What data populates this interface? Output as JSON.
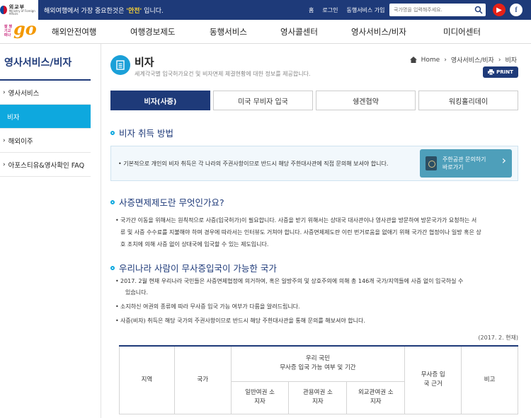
{
  "topbar": {
    "logo_main": "외교부",
    "logo_sub": "Ministry of Foreign Affairs",
    "slogan_before": "해외여행에서 가장 중요한것은 ",
    "slogan_highlight": "'안전'",
    "slogan_after": " 입니다.",
    "links": [
      "홈",
      "로그인",
      "동행서비스 가입"
    ],
    "search_placeholder": "국가명을 입력해주세요.",
    "youtube_label": "▶",
    "facebook_label": "f"
  },
  "brand": {
    "small": "잘 챙기고 떠나",
    "big": "go"
  },
  "nav": {
    "items": [
      "해외안전여행",
      "여행경보제도",
      "동행서비스",
      "영사콜센터",
      "영사서비스/비자",
      "미디어센터"
    ]
  },
  "sidebar": {
    "title": "영사서비스/비자",
    "items": [
      {
        "label": "영사서비스",
        "active": false
      },
      {
        "label": "비자",
        "active": true
      },
      {
        "label": "해외이주",
        "active": false
      },
      {
        "label": "아포스티유&영사확인 FAQ",
        "active": false
      }
    ]
  },
  "header": {
    "title": "비자",
    "description": "세계각국별 입국허가요건 및 비자면제 체결현황에 대한 정보를 제공합니다.",
    "breadcrumb": [
      "Home",
      "영사서비스/비자",
      "비자"
    ],
    "print_label": "PRINT"
  },
  "tabs": [
    {
      "label": "비자(사증)",
      "active": true
    },
    {
      "label": "미국 무비자 입국",
      "active": false
    },
    {
      "label": "쉥겐협약",
      "active": false
    },
    {
      "label": "워킹홀리데이",
      "active": false
    }
  ],
  "section1": {
    "title": "비자 취득 방법",
    "info": "• 기본적으로 개인의 비자 취득은 각 나라의 주권사항이므로 반드시 해당 주한대사관에 직접 문의해 보셔야 합니다.",
    "button_line1": "주한공관 문의하기",
    "button_line2": "바로가기"
  },
  "section2": {
    "title": "사증면제제도란 무엇인가요?",
    "line1": "국가간 이동을 위해서는 원칙적으로 사증(입국허가)이 필요합니다. 사증을 받기 위해서는 상대국 대사관이나 영사관을 방문하여 방문국가가 요청하는 서",
    "line2": "류 및 사증 수수료를 지불해야 하며 경우에 따라서는 인터뷰도 거쳐야 합니다. 사증면제제도란 이런 번거로움을 없애기 위해 국가간 협정이나 일방 혹은 상",
    "line3": "호 조치에 의해 사증 없이 상대국에 입국할 수 있는 제도입니다."
  },
  "section3": {
    "title": "우리나라 사람이 무사증입국이 가능한 국가",
    "bullet1_line1": "2017. 2월 현재 우리나라 국민들은 사증면제협정에 의거하여, 혹은 일방주의 및 상호주의에 의해 총 146개 국가/지역들에 사증 없이 입국하실 수",
    "bullet1_line2": "있습니다.",
    "bullet2": "소지하신 여권의 종류에 따라 무사증 입국 가능 여부가 다름을 알려드립니다.",
    "bullet3": "사증(비자) 취득은 해당 국가의 주권사항이므로 반드시 해당 주한대사관을 통해 문의를 해보셔야 합니다."
  },
  "table": {
    "date_note": "(2017. 2. 현재)",
    "col_region": "지역",
    "col_country": "국가",
    "col_group_line1": "우리 국민",
    "col_group_line2": "무사증 입국 가능 여부 및 기간",
    "col_ordinary": "일반여권 소지자",
    "col_official": "관용여권 소지자",
    "col_diplomatic": "외교관여권 소지자",
    "col_basis": "무사증 입국 근거",
    "col_note": "비고"
  },
  "colors": {
    "navy": "#1e3a79",
    "sky": "#0ea8de"
  }
}
